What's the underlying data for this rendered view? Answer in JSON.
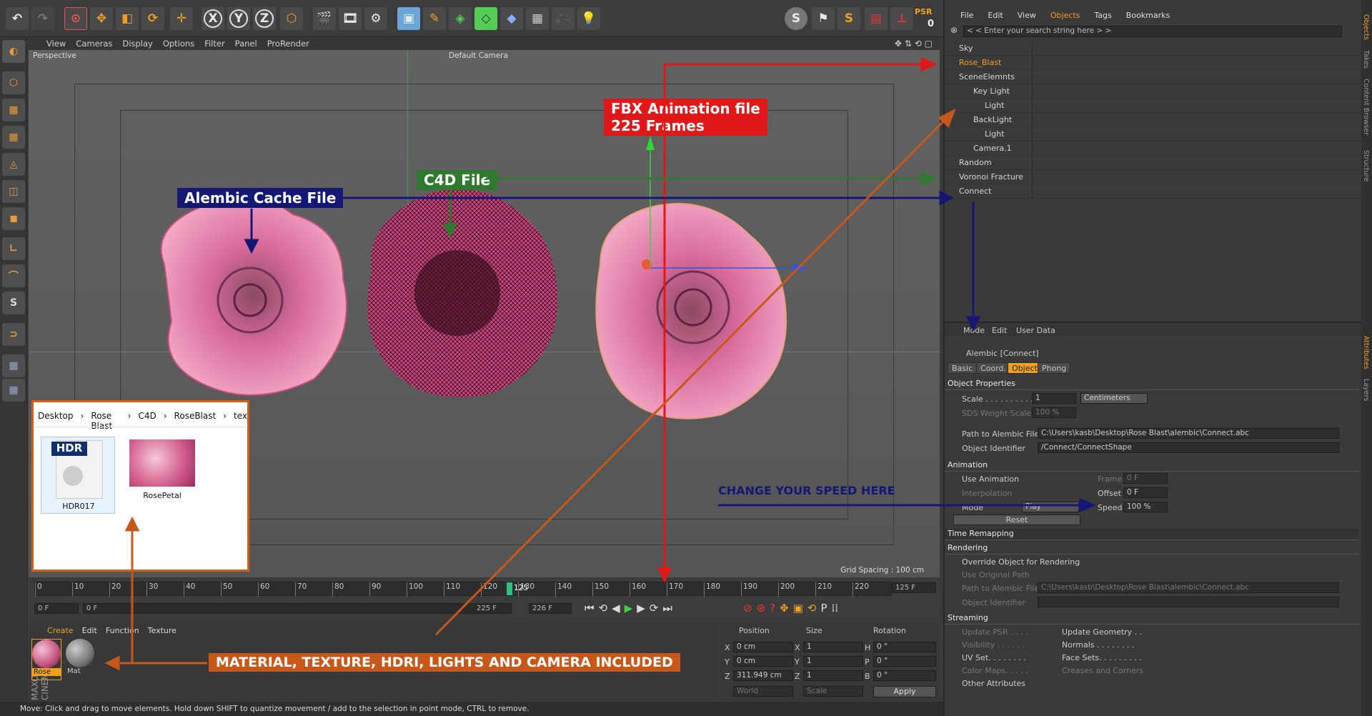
{
  "toolbar": {
    "psr_label": "PSR",
    "psr_value": "0",
    "icons": [
      "undo-icon",
      "redo-icon",
      "select-icon",
      "move-icon",
      "scale-icon",
      "rotate-icon",
      "add-icon",
      "x-axis-icon",
      "y-axis-icon",
      "z-axis-icon",
      "coordinate-system-icon",
      "render-view-icon",
      "render-picture-icon",
      "render-settings-icon",
      "model-mode-icon",
      "sculpt-icon",
      "generator-icon",
      "deformer-icon",
      "scene-icon",
      "floor-icon",
      "camera-icon",
      "light-icon"
    ]
  },
  "viewport": {
    "menu": [
      "View",
      "Cameras",
      "Display",
      "Options",
      "Filter",
      "Panel",
      "ProRender"
    ],
    "mode_label": "Perspective",
    "camera_label": "Default Camera",
    "grid_spacing": "Grid Spacing : 100 cm"
  },
  "annotations": {
    "fbx": "FBX Animation file\n225 Frames",
    "c4d": "C4D File",
    "alembic": "Alembic Cache File",
    "speed": "CHANGE YOUR SPEED  HERE",
    "included": "MATERIAL, TEXTURE,  HDRI, LIGHTS AND CAMERA INCLUDED"
  },
  "explorer": {
    "breadcrumb": [
      "Desktop",
      "Rose Blast",
      "C4D",
      "RoseBlast",
      "tex"
    ],
    "files": [
      {
        "name": "HDR017",
        "badge": "HDR"
      },
      {
        "name": "RosePetal"
      }
    ]
  },
  "timeline": {
    "ticks": [
      "0",
      "10",
      "20",
      "30",
      "40",
      "50",
      "60",
      "70",
      "80",
      "90",
      "100",
      "110",
      "120",
      "130",
      "140",
      "150",
      "160",
      "170",
      "180",
      "190",
      "200",
      "210",
      "220"
    ],
    "current": "125",
    "end_frame_box": "125 F",
    "start_field": "0 F",
    "range_start": "0 F",
    "range_end": "225 F",
    "max_field": "226 F"
  },
  "materials": {
    "menu": [
      "Create",
      "Edit",
      "Function",
      "Texture"
    ],
    "items": [
      {
        "name": "Rose"
      },
      {
        "name": "Mat"
      }
    ]
  },
  "coordinates": {
    "headers": [
      "Position",
      "Size",
      "Rotation"
    ],
    "rows": [
      {
        "axis": "X",
        "pos": "0 cm",
        "saxis": "X",
        "size": "1",
        "raxis": "H",
        "rot": "0 °"
      },
      {
        "axis": "Y",
        "pos": "0 cm",
        "saxis": "Y",
        "size": "1",
        "raxis": "P",
        "rot": "0 °"
      },
      {
        "axis": "Z",
        "pos": "311.949 cm",
        "saxis": "Z",
        "size": "1",
        "raxis": "B",
        "rot": "0 °"
      }
    ],
    "world": "World",
    "scale": "Scale",
    "apply": "Apply"
  },
  "status": "Move: Click and drag to move elements. Hold down SHIFT to quantize movement / add to the selection in point mode, CTRL to remove.",
  "objects_panel": {
    "menu": [
      "File",
      "Edit",
      "View",
      "Objects",
      "Tags",
      "Bookmarks"
    ],
    "search_placeholder": "< < Enter your search string here > >",
    "items": [
      {
        "name": "Sky",
        "indent": 0
      },
      {
        "name": "Rose_Blast",
        "indent": 0,
        "highlight": true
      },
      {
        "name": "SceneElemnts",
        "indent": 0
      },
      {
        "name": "Key Light",
        "indent": 1
      },
      {
        "name": "Light",
        "indent": 2
      },
      {
        "name": "BackLight",
        "indent": 1
      },
      {
        "name": "Light",
        "indent": 2
      },
      {
        "name": "Camera.1",
        "indent": 1
      },
      {
        "name": "Random",
        "indent": 0
      },
      {
        "name": "Voronoi Fracture",
        "indent": 0
      },
      {
        "name": "Connect",
        "indent": 0
      }
    ]
  },
  "side_tabs": [
    "Objects",
    "Takes",
    "Content Browser",
    "Structure",
    "Attributes",
    "Layers"
  ],
  "attributes": {
    "menu": [
      "Mode",
      "Edit",
      "User Data"
    ],
    "title": "Alembic [Connect]",
    "tabs": [
      "Basic",
      "Coord.",
      "Object",
      "Phong"
    ],
    "object_properties": "Object Properties",
    "scale_label": "Scale . . . . . . . . . .",
    "scale_value": "1",
    "unit": "Centimeters",
    "sds_label": "SDS Weight Scale",
    "sds_value": "100 %",
    "path_label": "Path to Alembic File",
    "path_value": "C:\\Users\\kasb\\Desktop\\Rose Blast\\alembic\\Connect.abc",
    "id_label": "Object Identifier",
    "id_value": "/Connect/ConnectShape",
    "animation": "Animation",
    "use_anim": "Use Animation",
    "interp": "Interpolation",
    "mode": "Mode",
    "mode_value": "Play",
    "frame": "Frame",
    "frame_value": "0 F",
    "offset": "Offset",
    "offset_value": "0 F",
    "speed": "Speed",
    "speed_value": "100 %",
    "reset": "Reset",
    "time_remap": "Time Remapping",
    "rendering": "Rendering",
    "override": "Override Object for Rendering",
    "orig_path": "Use Original Path",
    "r_path_label": "Path to Alembic File",
    "r_path_value": "C:\\Users\\kasb\\Desktop\\Rose Blast\\alembic\\Connect.abc",
    "r_id_label": "Object Identifier",
    "streaming": "Streaming",
    "stream_left": [
      "Update PSR . . . .",
      "Visibility . . . . . .",
      "UV Set. . . . . . . .",
      "Color Maps. . . . .",
      "Other Attributes"
    ],
    "stream_right": [
      "Update Geometry . .",
      "Normals . . . . . . . .",
      "Face Sets. . . . . . . . .",
      "Creases and Corners"
    ]
  },
  "colors": {
    "accent": "#d1601b",
    "red": "#e02020",
    "green": "#2e8b2e",
    "navy": "#141875",
    "orange_arrow": "#c8581a"
  }
}
